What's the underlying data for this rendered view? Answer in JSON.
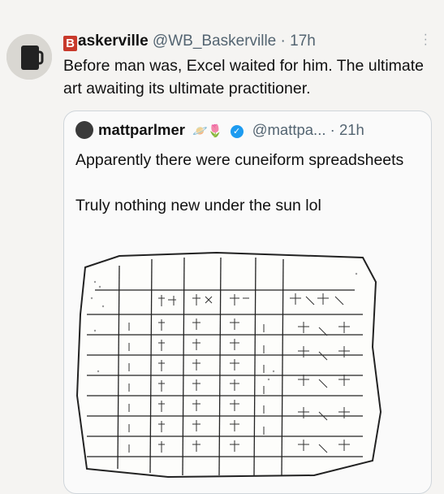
{
  "tweet": {
    "brand_letter": "B",
    "display_name": "askerville",
    "handle": "@WB_Baskerville",
    "separator": "·",
    "time": "17h",
    "text": "Before man was, Excel waited for him. The ultimate art awaiting its ultimate practitioner."
  },
  "quote": {
    "display_name": "mattparlmer",
    "emoji": "🪐🌷",
    "handle": "@mattpa...",
    "separator": "·",
    "time": "21h",
    "line1": "Apparently there were cuneiform spreadsheets",
    "line2": "Truly nothing new under the sun lol",
    "image": {
      "icon": "cuneiform-tablet-drawing"
    }
  },
  "colors": {
    "background": "#f5f4f2",
    "handle": "#536471",
    "verified": "#1d9bf0",
    "brand_badge": "#c8392b"
  }
}
